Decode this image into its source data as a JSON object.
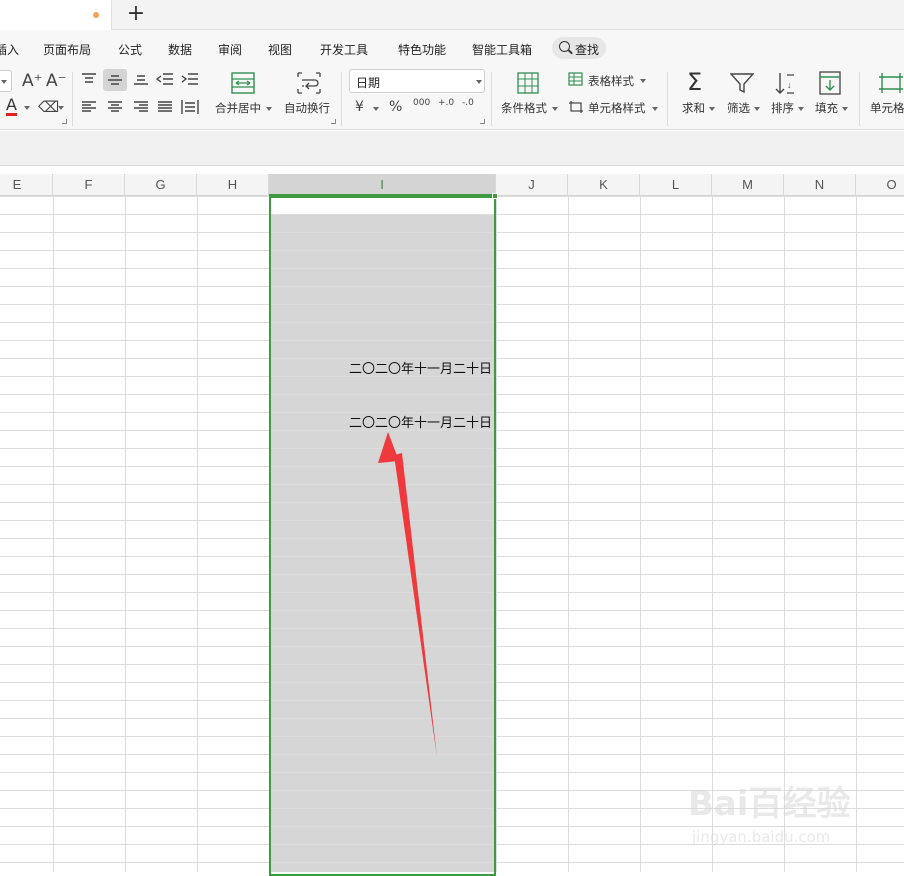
{
  "tabs": {
    "new_tab_label": "+"
  },
  "menu": {
    "items": [
      "插入",
      "页面布局",
      "公式",
      "数据",
      "审阅",
      "视图",
      "开发工具",
      "特色功能",
      "智能工具箱"
    ],
    "search_label": "查找"
  },
  "ribbon": {
    "font_grow": "A⁺",
    "font_shrink": "A⁻",
    "font_color": "A",
    "merge_label": "合并居中",
    "wrap_label": "自动换行",
    "number_format": "日期",
    "currency_symbol": "¥",
    "percent_symbol": "%",
    "thousands_symbol": "000",
    "decimal_inc": "+.0",
    "decimal_dec": "-.0",
    "conditional_format": "条件格式",
    "table_style": "表格样式",
    "cell_style": "单元格样式",
    "sum_label": "求和",
    "filter_label": "筛选",
    "sort_label": "排序",
    "fill_label": "填充",
    "cell_label": "单元格"
  },
  "sheet": {
    "columns": [
      "E",
      "F",
      "G",
      "H",
      "I",
      "J",
      "K",
      "L",
      "M",
      "N",
      "O"
    ],
    "selected_column": "I",
    "cells": [
      {
        "row_index": 9,
        "text": "二〇二〇年十一月二十日"
      },
      {
        "row_index": 12,
        "text": "二〇二〇年十一月二十日"
      }
    ]
  },
  "colors": {
    "selection": "#3f9a3f",
    "selection_fill": "#d6d6d6",
    "annotation_arrow": "#f0393d"
  },
  "watermark": {
    "logo": "Bai百经验",
    "url": "jingyan.baidu.com"
  }
}
